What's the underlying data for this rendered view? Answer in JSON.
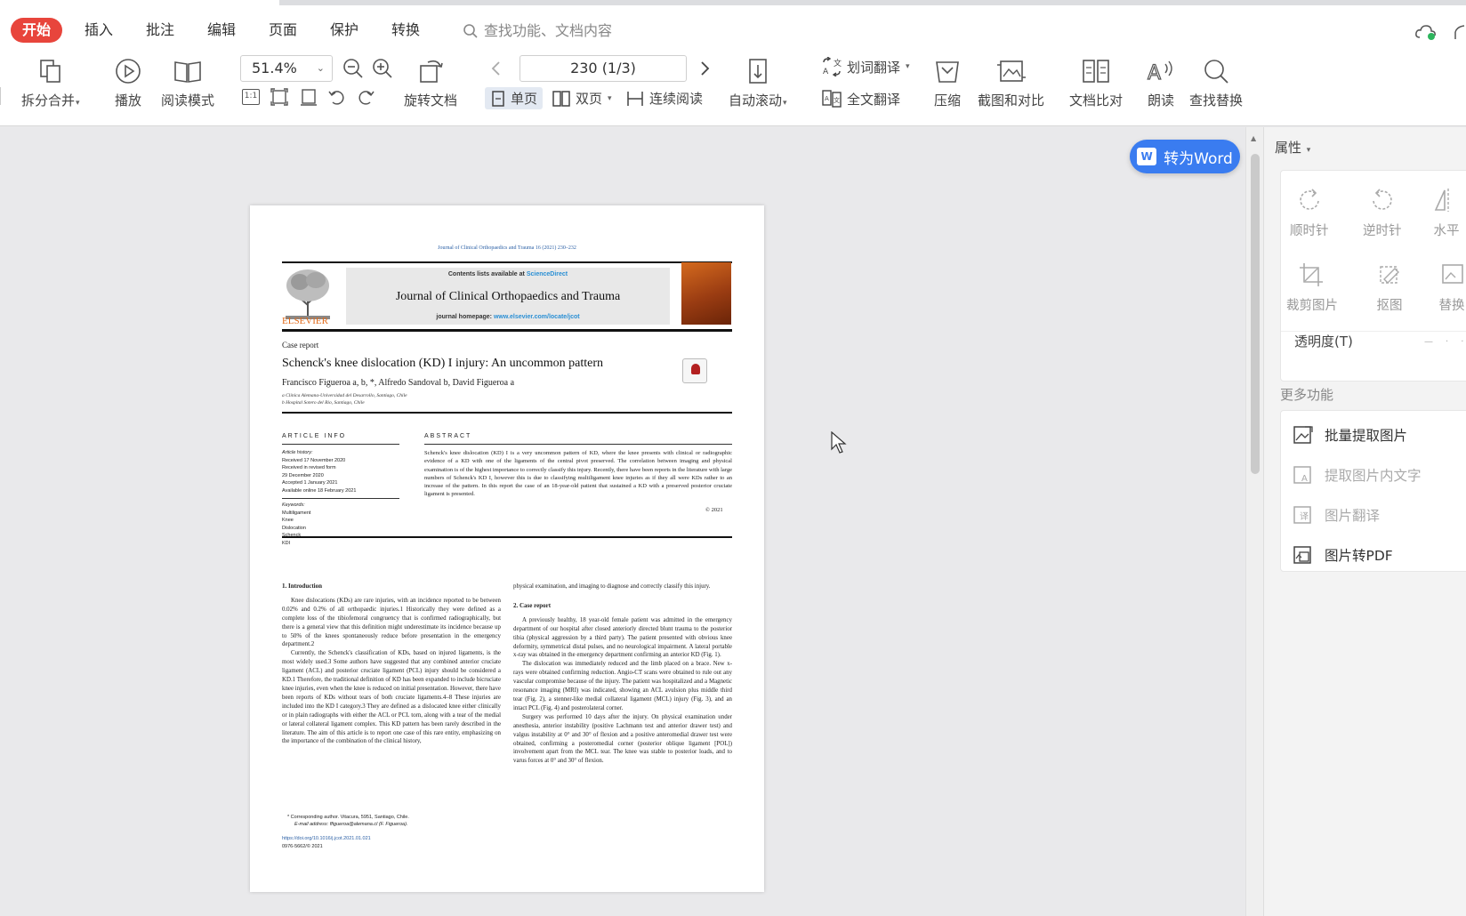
{
  "menu": {
    "tabs": [
      {
        "label": "开始",
        "active": true
      },
      {
        "label": "插入"
      },
      {
        "label": "批注"
      },
      {
        "label": "编辑"
      },
      {
        "label": "页面"
      },
      {
        "label": "保护"
      },
      {
        "label": "转换"
      }
    ],
    "search_placeholder": "查找功能、文档内容"
  },
  "toolbar": {
    "split_merge": "拆分合并",
    "play": "播放",
    "read_mode": "阅读模式",
    "zoom_value": "51.4%",
    "rotate_doc": "旋转文档",
    "page_value": "230 (1/3)",
    "single_page": "单页",
    "double_page": "双页",
    "continuous": "连续阅读",
    "auto_scroll": "自动滚动",
    "word_translate": "划词翻译",
    "full_translate": "全文翻译",
    "compress": "压缩",
    "screenshot_compare": "截图和对比",
    "doc_compare": "文档比对",
    "read_aloud": "朗读",
    "find_replace": "查找替换",
    "actual_size_label": "1:1"
  },
  "to_word_button": "转为Word",
  "document": {
    "top_citation": "Journal of Clinical Orthopaedics and Trauma 16 (2021) 230–232",
    "contents_prefix": "Contents lists available at",
    "sciencedirect": "ScienceDirect",
    "journal_title": "Journal of Clinical Orthopaedics and Trauma",
    "homepage_prefix": "journal homepage:",
    "homepage_url": "www.elsevier.com/locate/jcot",
    "publisher": "ELSEVIER",
    "article_type": "Case report",
    "title": "Schenck's knee dislocation (KD) I injury: An uncommon pattern",
    "authors": "Francisco Figueroa a, b, *, Alfredo Sandoval b, David Figueroa a",
    "affil_a": "a Clínica Alemana-Universidad del Desarrollo, Santiago, Chile",
    "affil_b": "b Hospital Sotero del Rio, Santiago, Chile",
    "article_info_label": "ARTICLE INFO",
    "abstract_label": "ABSTRACT",
    "article_history": "Article history:",
    "received": "Received 17 November 2020",
    "revised_1": "Received in revised form",
    "revised_2": "29 December 2020",
    "accepted": "Accepted 1 January 2021",
    "available": "Available online 18 February 2021",
    "keywords_label": "Keywords:",
    "keywords": [
      "Multiligament",
      "Knee",
      "Dislocation",
      "Schenck",
      "KDI"
    ],
    "abstract": "Schenck's knee dislocation (KD) I is a very uncommon pattern of KD, where the knee presents with clinical or radiographic evidence of a KD with one of the ligaments of the central pivot preserved. The correlation between imaging and physical examination is of the highest importance to correctly classify this injury. Recently, there have been reports in the literature with large numbers of Schenck's KD I, however this is due to classifying multiligament knee injuries as if they all were KDs rather to an increase of the pattern. In this report the case of an 18-year-old patient that sustained a KD with a preserved posterior cruciate ligament is presented.",
    "copyright": "© 2021",
    "intro_heading": "1. Introduction",
    "intro_p1": "Knee dislocations (KDs) are rare injuries, with an incidence reported to be between 0.02% and 0.2% of all orthopaedic injuries.1 Historically they were defined as a complete loss of the tibiofemoral congruency that is confirmed radiographically, but there is a general view that this definition might underestimate its incidence because up to 50% of the knees spontaneously reduce before presentation in the emergency department.2",
    "intro_p2": "Currently, the Schenck's classification of KDs, based on injured ligaments, is the most widely used.3 Some authors have suggested that any combined anterior cruciate ligament (ACL) and posterior cruciate ligament (PCL) injury should be considered a KD.1 Therefore, the traditional definition of KD has been expanded to include bicruciate knee injuries, even when the knee is reduced on initial presentation. However, there have been reports of KDs without tears of both cruciate ligaments.4–8 These injuries are included into the KD I category.3 They are defined as a dislocated knee either clinically or in plain radiographs with either the ACL or PCL torn, along with a tear of the medial or lateral collateral ligament complex. This KD pattern has been rarely described in the literature. The aim of this article is to report one case of this rare entity, emphasizing on the importance of the combination of the clinical history,",
    "col2_p0": "physical examination, and imaging to diagnose and correctly classify this injury.",
    "case_heading": "2. Case report",
    "case_p1": "A previously healthy, 18 year-old female patient was admitted in the emergency department of our hospital after closed anteriorly directed blunt trauma to the posterior tibia (physical aggression by a third party). The patient presented with obvious knee deformity, symmetrical distal pulses, and no neurological impairment. A lateral portable x-ray was obtained in the emergency department confirming an anterior KD (Fig. 1).",
    "case_p2": "The dislocation was immediately reduced and the limb placed on a brace. New x-rays were obtained confirming reduction. Angio-CT scans were obtained to rule out any vascular compromise because of the injury. The patient was hospitalized and a Magnetic resonance imaging (MRI) was indicated, showing an ACL avulsion plus middle third tear (Fig. 2), a stenner-like medial collateral ligament (MCL) injury (Fig. 3), and an intact PCL (Fig. 4) and posterolateral corner.",
    "case_p3": "Surgery was performed 10 days after the injury. On physical examination under anesthesia, anterior instability (positive Lachmann test and anterior drawer test) and valgus instability at 0° and 30° of flexion and a positive anteromedial drawer test were obtained, confirming a posteromedial corner (posterior oblique ligament [POL]) involvement apart from the MCL tear. The knee was stable to posterior loads, and to varus forces at 0° and 30° of flexion.",
    "corresponding": "* Corresponding author. Vitacura, 5951, Santiago, Chile.",
    "email": "E-mail address: ffigueroa@alemana.cl (F. Figueroa).",
    "doi": "https://doi.org/10.1016/j.jcot.2021.01.021",
    "issn": "0976-5662/© 2021"
  },
  "right_panel": {
    "title": "属性",
    "tools_row1": [
      "顺时针",
      "逆时针",
      "水平"
    ],
    "tools_row2": [
      "裁剪图片",
      "抠图",
      "替换"
    ],
    "opacity_label": "透明度(T)",
    "more_title": "更多功能",
    "more_items": [
      {
        "label": "批量提取图片",
        "enabled": true
      },
      {
        "label": "提取图片内文字",
        "enabled": false
      },
      {
        "label": "图片翻译",
        "enabled": false
      },
      {
        "label": "图片转PDF",
        "enabled": true
      }
    ]
  },
  "colors": {
    "active_tab": "#e8453c",
    "to_word_button": "#3a7cf0",
    "link_blue": "#2a5fa5",
    "elsevier_orange": "#e06a1a"
  }
}
